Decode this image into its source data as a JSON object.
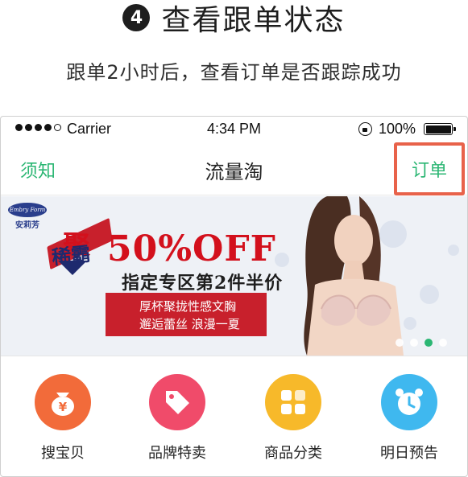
{
  "step": {
    "number": "4",
    "title": "查看跟单状态",
    "description": "跟单2小时后，查看订单是否跟踪成功"
  },
  "status_bar": {
    "carrier": "Carrier",
    "time": "4:34 PM",
    "battery": "100%",
    "battery_level": 1.0
  },
  "nav": {
    "left": "须知",
    "title": "流量淘",
    "right": "订单",
    "accent_color": "#2bb673",
    "highlight_color": "#e8624a"
  },
  "banner": {
    "brand_en": "Embry Form",
    "brand_cn": "安莉芳",
    "promo_big": "聚",
    "promo_small": "稀霸",
    "discount": "50%OFF",
    "subtitle": "指定专区第2件半价",
    "box_line1": "厚杯聚拢性感文胸",
    "box_line2": "邂逅蕾丝 浪漫一夏",
    "active_slide": 3,
    "slide_count": 4
  },
  "categories": [
    {
      "label": "搜宝贝",
      "icon": "yen-bag-icon",
      "color": "#f26b3a"
    },
    {
      "label": "品牌特卖",
      "icon": "price-tag-icon",
      "color": "#f04b6a"
    },
    {
      "label": "商品分类",
      "icon": "grid-icon",
      "color": "#f7b92a"
    },
    {
      "label": "明日预告",
      "icon": "alarm-clock-icon",
      "color": "#3fb8ef"
    }
  ]
}
